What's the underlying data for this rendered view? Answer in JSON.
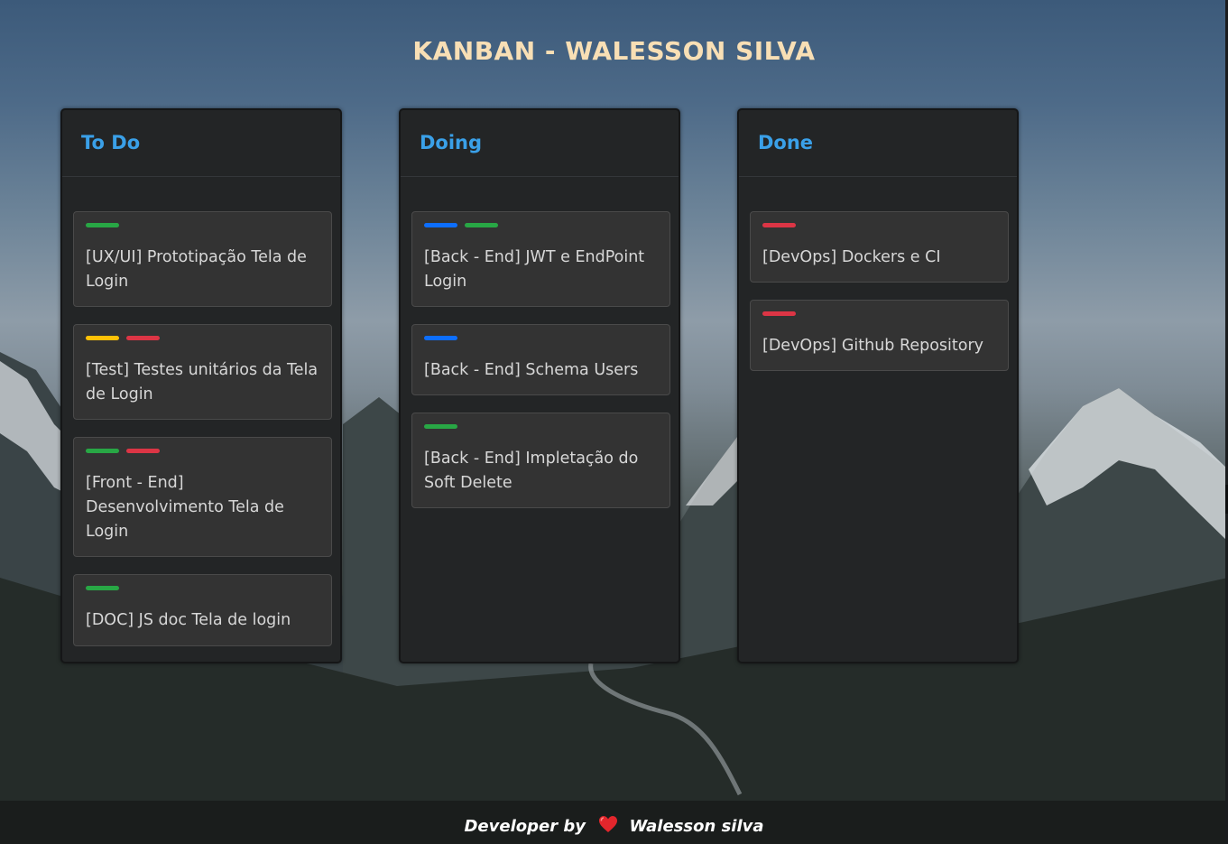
{
  "page": {
    "title": "KANBAN - WALESSON SILVA"
  },
  "colors": {
    "blue": "#0d6efd",
    "green": "#28a745",
    "yellow": "#ffc107",
    "red": "#dc3545",
    "accent": "#3aa0e8",
    "title": "#f8dfb5"
  },
  "columns": [
    {
      "title": "To Do",
      "cards": [
        {
          "tags": [
            "green"
          ],
          "text": "[UX/UI] Prototipação Tela de Login"
        },
        {
          "tags": [
            "yellow",
            "red"
          ],
          "text": "[Test] Testes unitários da Tela de Login"
        },
        {
          "tags": [
            "green",
            "red"
          ],
          "text": "[Front - End] Desenvolvimento Tela de Login"
        },
        {
          "tags": [
            "green"
          ],
          "text": "[DOC] JS doc Tela de login"
        }
      ]
    },
    {
      "title": "Doing",
      "cards": [
        {
          "tags": [
            "blue",
            "green"
          ],
          "text": "[Back - End] JWT e EndPoint Login"
        },
        {
          "tags": [
            "blue"
          ],
          "text": "[Back - End] Schema Users"
        },
        {
          "tags": [
            "green"
          ],
          "text": "[Back - End] Impletação do Soft Delete"
        }
      ]
    },
    {
      "title": "Done",
      "cards": [
        {
          "tags": [
            "red"
          ],
          "text": "[DevOps] Dockers e CI"
        },
        {
          "tags": [
            "red"
          ],
          "text": "[DevOps] Github Repository"
        }
      ]
    }
  ],
  "footer": {
    "prefix": "Developer by",
    "icon": "heart-icon",
    "author": "Walesson silva"
  }
}
